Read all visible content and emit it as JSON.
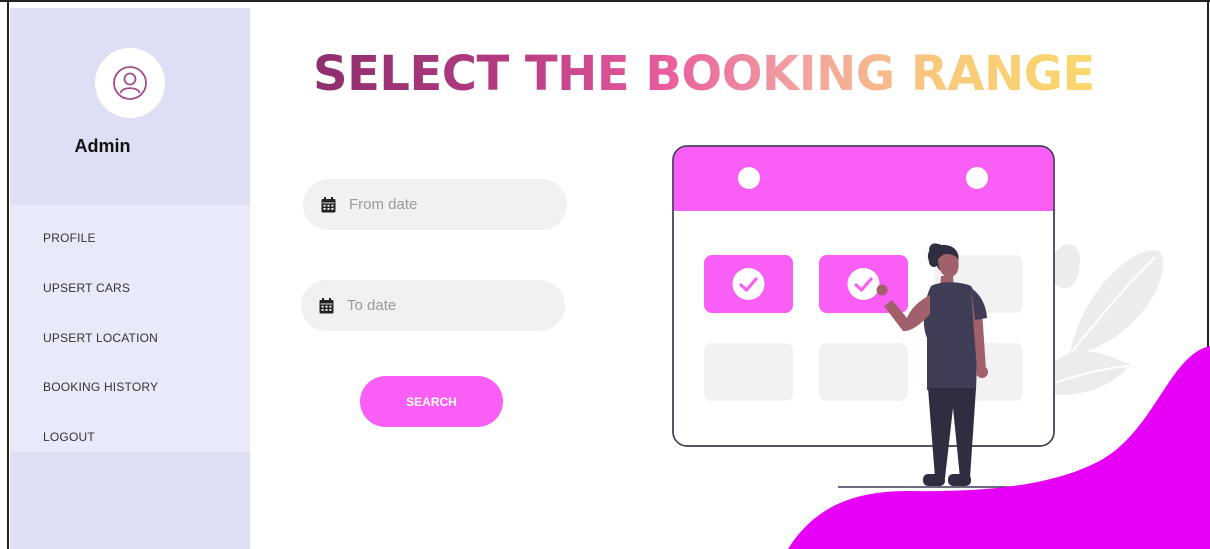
{
  "sidebar": {
    "user_name": "Admin",
    "avatar_icon": "user-circle-icon",
    "items": [
      {
        "label": "PROFILE"
      },
      {
        "label": "UPSERT CARS"
      },
      {
        "label": "UPSERT LOCATION"
      },
      {
        "label": "BOOKING HISTORY"
      },
      {
        "label": "LOGOUT"
      }
    ]
  },
  "main": {
    "title": "SELECT THE BOOKING RANGE",
    "from_date": {
      "placeholder": "From date",
      "value": "",
      "icon": "calendar-icon"
    },
    "to_date": {
      "placeholder": "To date",
      "value": "",
      "icon": "calendar-icon"
    },
    "search_label": "SEARCH"
  },
  "colors": {
    "accent": "#f95ef5",
    "wave": "#e600f5",
    "sidebar_bg": "#dde0f4",
    "nav_bg": "#e8eaf9"
  }
}
